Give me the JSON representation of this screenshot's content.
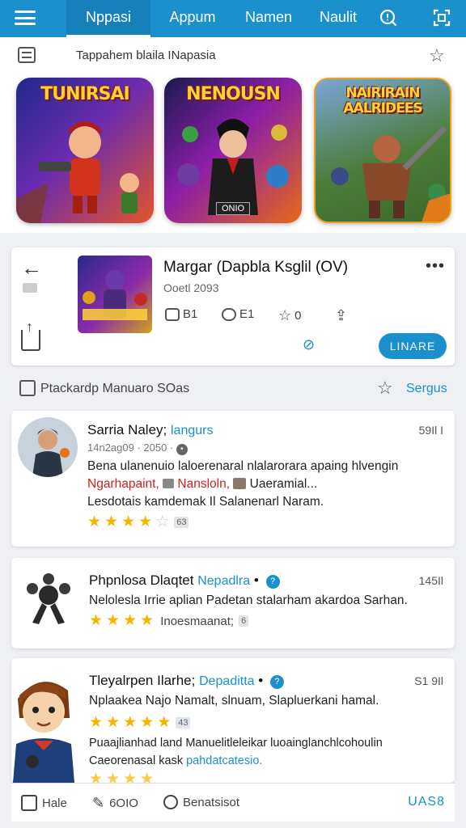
{
  "nav": {
    "tabs": [
      {
        "label": "Nppasi",
        "active": true
      },
      {
        "label": "Appum"
      },
      {
        "label": "Namen"
      },
      {
        "label": "Naulit"
      }
    ],
    "icons": [
      "menu-icon",
      "search-chat-icon",
      "expand-icon"
    ]
  },
  "subheader": {
    "title": "Tappahem blaila INapasia"
  },
  "carousel": [
    {
      "title": "TUNIRSAI",
      "colors": [
        "#2a2f8f",
        "#d2331c"
      ]
    },
    {
      "title": "NENOUSN",
      "badge": "ONIO",
      "colors": [
        "#2b1a4f",
        "#e04d1a"
      ]
    },
    {
      "title": "NAIRIRAIN AALRIDEES",
      "colors": [
        "#3b5a2a",
        "#d9b64a"
      ]
    }
  ],
  "game": {
    "title": "Margar (Dapbla Ksglil (OV)",
    "date": "Ooetl 2093",
    "stats": {
      "a": "B1",
      "b": "E1",
      "c": "0"
    },
    "button": "LINARE"
  },
  "reviews_header": {
    "label": "Ptackardp  Manuaro  SOas",
    "sort": "Sergus"
  },
  "reviews": [
    {
      "name": "Sarria Naley;",
      "tag": "langurs",
      "time": "59Il I",
      "sub": "14n2ag09 · 2050 ·",
      "line1": "Bena ulanenuio laloerenaral nlalarorara apaing hlvengin",
      "line2_red": "Ngarhapaint,",
      "line2_red2": "Nansloln,",
      "line2_rest": "Uaeramial...",
      "line3": "Lesdotais kamdemak Il Salanenarl Naram.",
      "stars": 4,
      "count": "63"
    },
    {
      "name": "Phpnlosa Dlaqtet",
      "tag": "Nepadlra",
      "time": "145Il",
      "line1": "Nelolesla Irrie aplian Padetan stalarham akardoa Sarhan.",
      "stars": 4,
      "note": "Inoesmaanat;",
      "count": "6"
    },
    {
      "name": "Tleyalrpen Ilarhe;",
      "tag": "Depaditta",
      "time": "S1 9Il",
      "line1": "Nplaakea Najo Namalt, slnuam, Slapluerkani hamal.",
      "stars": 5,
      "count": "43",
      "line3": "Puaajlianhad land Manuelitleleikar luoainglanchlcohoulin",
      "line4": "Caeorenasal kask",
      "line4_blue": "pahdatcatesio."
    }
  ],
  "bottombar": {
    "items": [
      "Hale",
      "6OIO",
      "Benatsisot"
    ],
    "action": "UAS8"
  },
  "colors": {
    "accent": "#1a90cc",
    "star": "#f5b400",
    "red_text": "#cc2222"
  }
}
